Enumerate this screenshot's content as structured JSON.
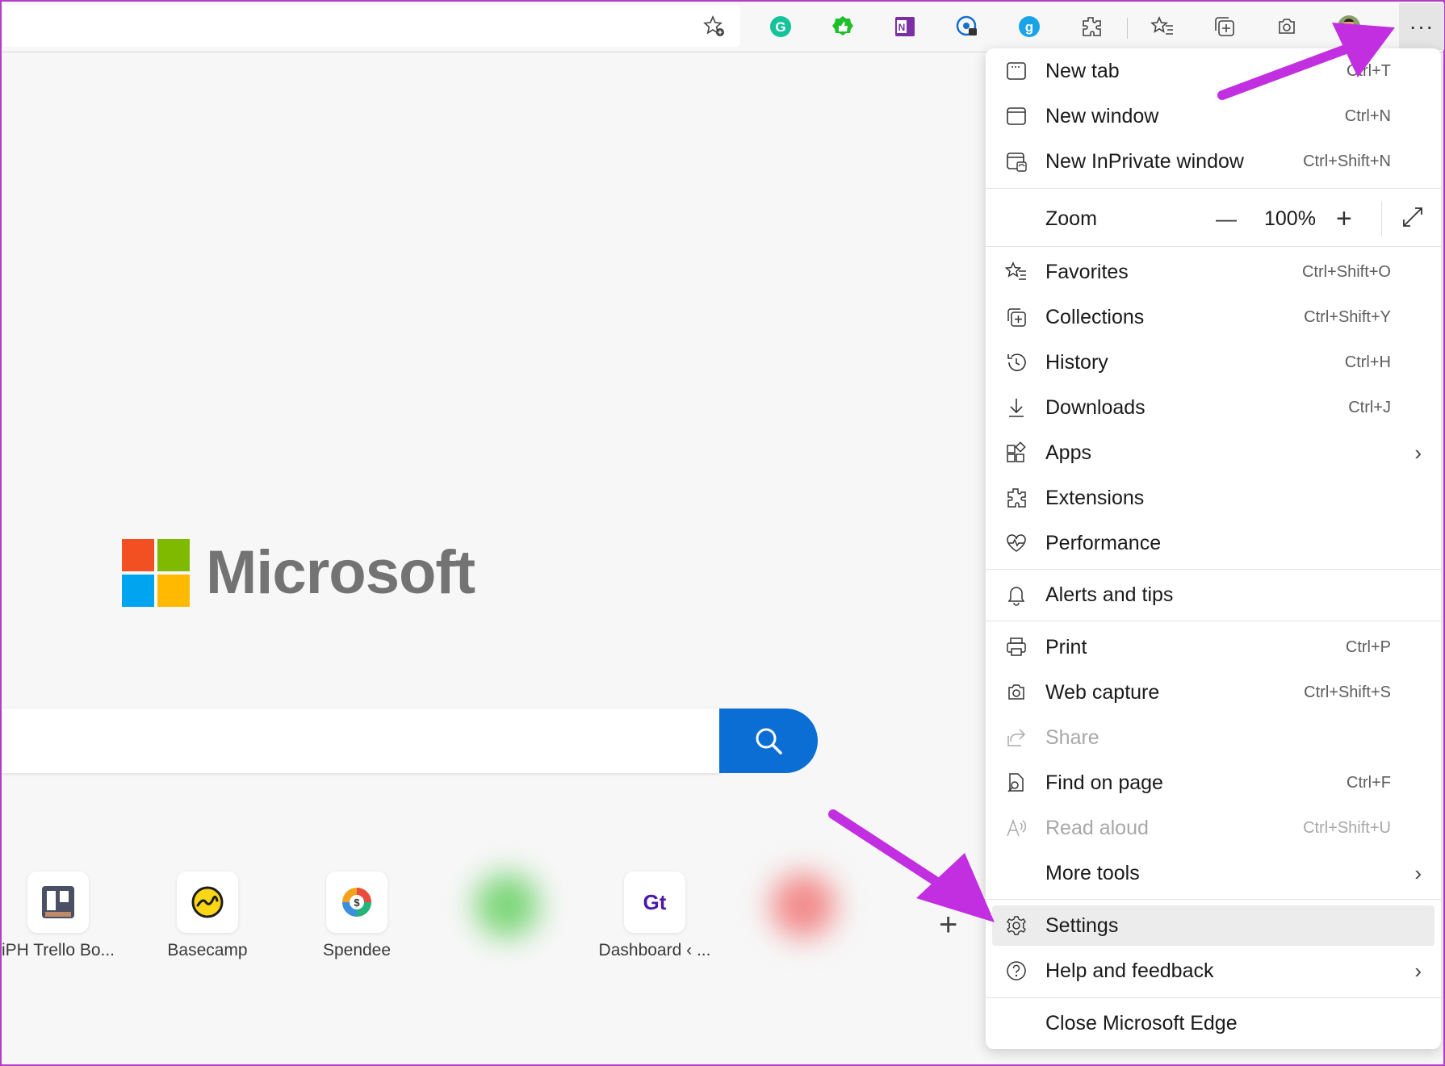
{
  "menu": {
    "new_tab": {
      "label": "New tab",
      "shortcut": "Ctrl+T"
    },
    "new_window": {
      "label": "New window",
      "shortcut": "Ctrl+N"
    },
    "new_inprivate": {
      "label": "New InPrivate window",
      "shortcut": "Ctrl+Shift+N"
    },
    "zoom": {
      "label": "Zoom",
      "value": "100%",
      "minus": "—",
      "plus": "+"
    },
    "favorites": {
      "label": "Favorites",
      "shortcut": "Ctrl+Shift+O"
    },
    "collections": {
      "label": "Collections",
      "shortcut": "Ctrl+Shift+Y"
    },
    "history": {
      "label": "History",
      "shortcut": "Ctrl+H"
    },
    "downloads": {
      "label": "Downloads",
      "shortcut": "Ctrl+J"
    },
    "apps": {
      "label": "Apps"
    },
    "extensions": {
      "label": "Extensions"
    },
    "performance": {
      "label": "Performance"
    },
    "alerts": {
      "label": "Alerts and tips"
    },
    "print": {
      "label": "Print",
      "shortcut": "Ctrl+P"
    },
    "web_capture": {
      "label": "Web capture",
      "shortcut": "Ctrl+Shift+S"
    },
    "share": {
      "label": "Share"
    },
    "find": {
      "label": "Find on page",
      "shortcut": "Ctrl+F"
    },
    "read_aloud": {
      "label": "Read aloud",
      "shortcut": "Ctrl+Shift+U"
    },
    "more_tools": {
      "label": "More tools"
    },
    "settings": {
      "label": "Settings"
    },
    "help": {
      "label": "Help and feedback"
    },
    "close": {
      "label": "Close Microsoft Edge"
    }
  },
  "page": {
    "logo_text": "Microsoft",
    "tiles": [
      "iPH Trello Bo...",
      "Basecamp",
      "Spendee",
      "Dashboard ‹ ..."
    ],
    "add_tile": "+"
  },
  "toolbar": {
    "more_label": "···",
    "extension_icons": [
      "grammarly-icon",
      "evernote-like-icon",
      "onenote-icon",
      "password-icon",
      "grammarly-go-icon",
      "extensions-icon",
      "favorites-icon",
      "collections-icon",
      "web-capture-icon",
      "profile-avatar"
    ]
  },
  "colors": {
    "accent": "#0b6ed4",
    "arrow": "#c12fe0",
    "ms_red": "#f25022",
    "ms_green": "#7fba00",
    "ms_blue": "#00a4ef",
    "ms_yellow": "#ffb900"
  }
}
